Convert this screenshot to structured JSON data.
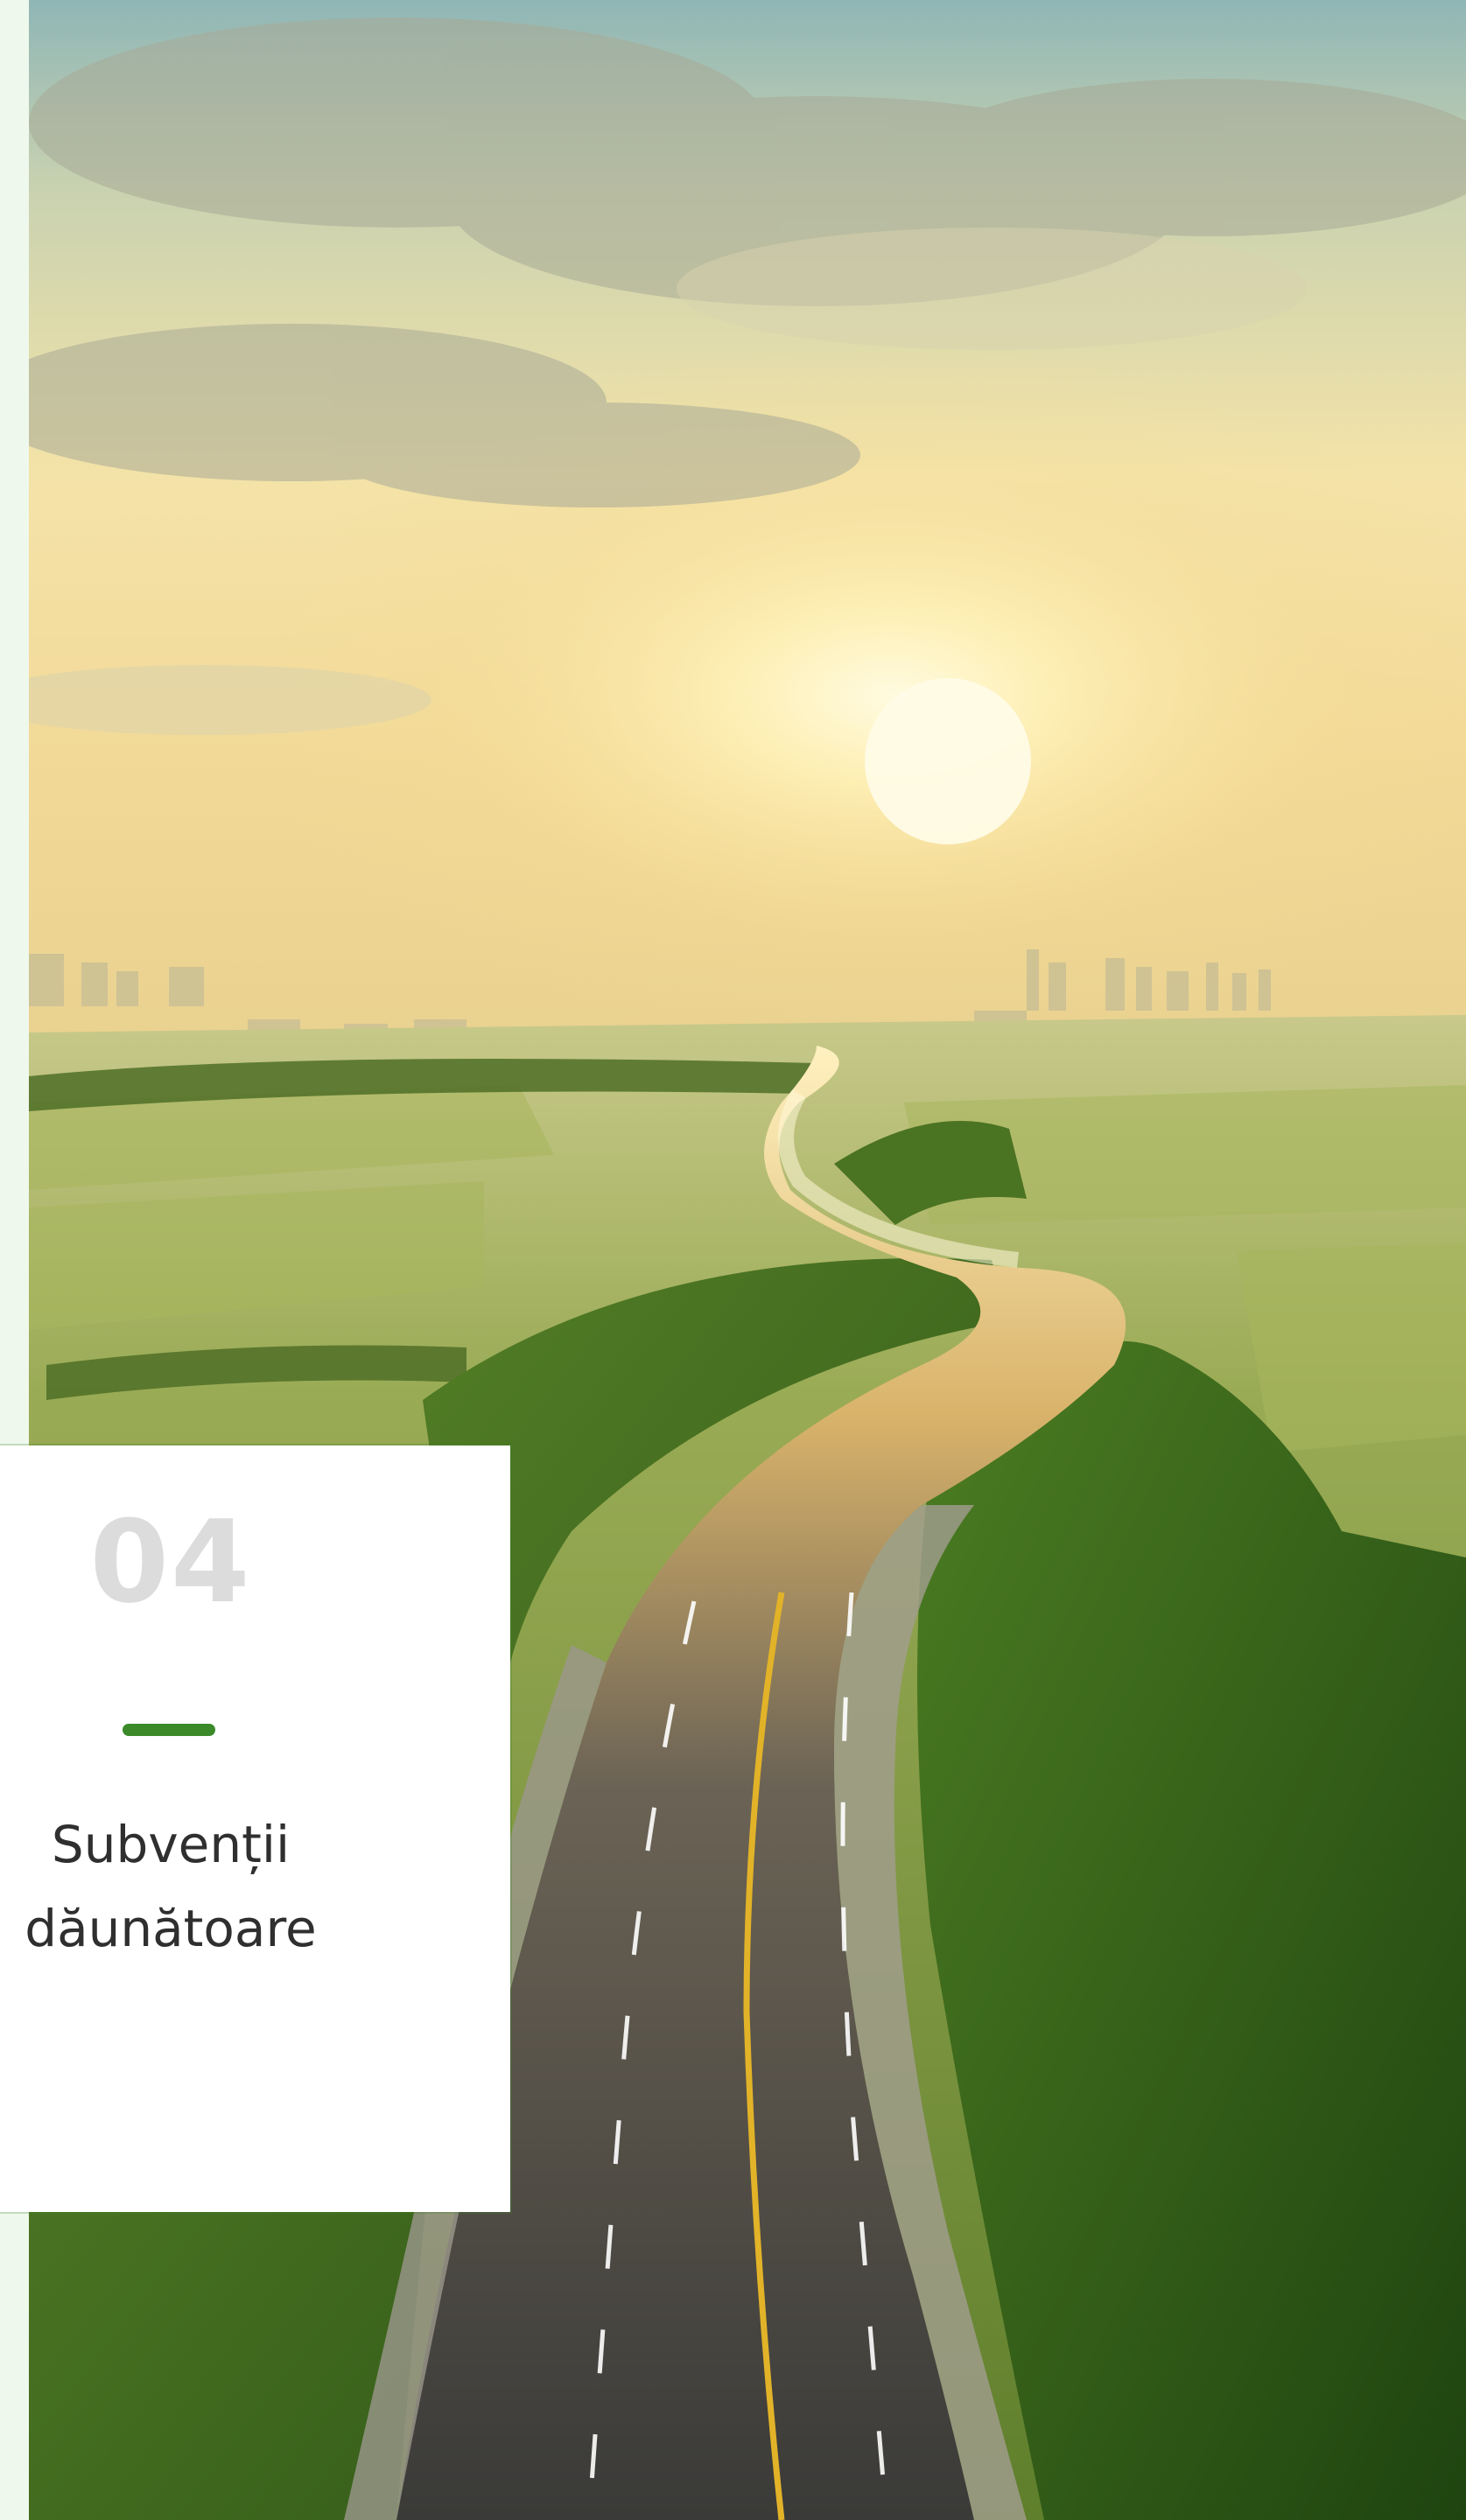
{
  "card": {
    "number": "04",
    "title": "Subvenții dăunătoare",
    "accent_color": "#3b8a2a",
    "number_color": "#dcdcdc",
    "text_color": "#2f2f2f"
  },
  "hero": {
    "scene": "aerial-highway-sunrise",
    "colors": {
      "sky_top": "#8fb7b5",
      "sun": "#fff6c8",
      "haze": "#f2dda0",
      "fields": "#7e9a3e",
      "forest": "#2f5a1a",
      "road": "#3f3f3d"
    }
  }
}
